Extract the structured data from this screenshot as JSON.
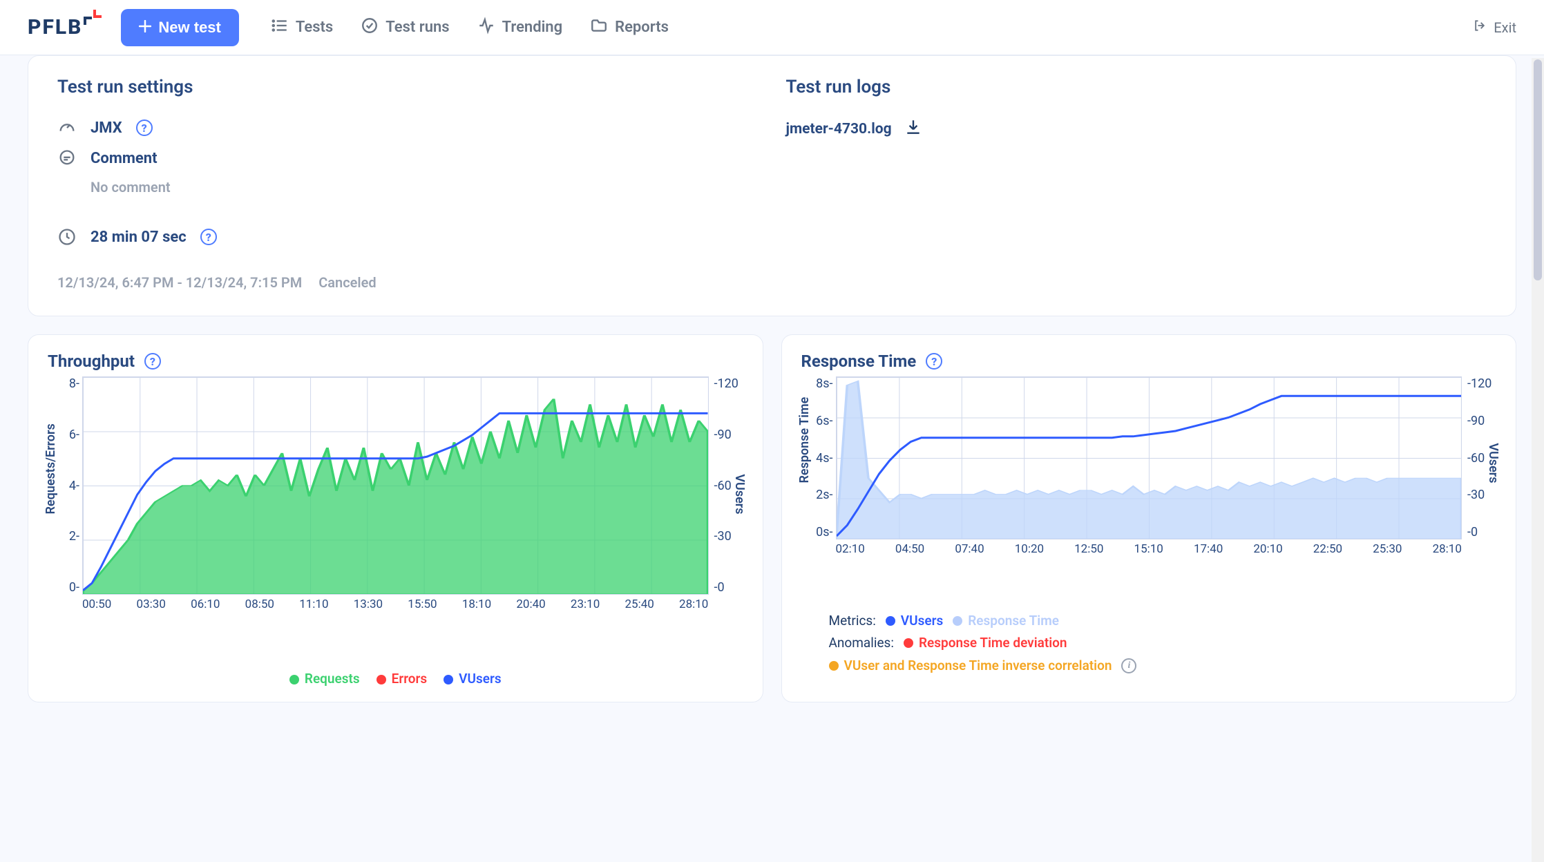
{
  "header": {
    "logo_text": "PFLB",
    "new_test_label": "New test",
    "nav": {
      "tests": "Tests",
      "test_runs": "Test runs",
      "trending": "Trending",
      "reports": "Reports"
    },
    "exit_label": "Exit"
  },
  "settings_card": {
    "title_left": "Test run settings",
    "title_right": "Test run logs",
    "jmx_label": "JMX",
    "comment_label": "Comment",
    "comment_value": "No comment",
    "duration_label": "28 min 07 sec",
    "timespan": "12/13/24, 6:47 PM - 12/13/24, 7:15 PM",
    "status": "Canceled",
    "log_file": "jmeter-4730.log"
  },
  "throughput_panel": {
    "title": "Throughput",
    "ylabel_left": "Requests/Errors",
    "ylabel_right": "VUsers",
    "legend": {
      "requests": "Requests",
      "errors": "Errors",
      "vusers": "VUsers"
    }
  },
  "response_panel": {
    "title": "Response Time",
    "ylabel_left": "Response Time",
    "ylabel_right": "VUsers",
    "metrics_label": "Metrics:",
    "anomalies_label": "Anomalies:",
    "legend": {
      "vusers": "VUsers",
      "response_time": "Response Time",
      "rt_deviation": "Response Time deviation",
      "inverse": "VUser and Response Time inverse correlation"
    }
  },
  "chart_data": [
    {
      "id": "throughput",
      "type": "line+area",
      "xticks": [
        "00:50",
        "03:30",
        "06:10",
        "08:50",
        "11:10",
        "13:30",
        "15:50",
        "18:10",
        "20:40",
        "23:10",
        "25:40",
        "28:10"
      ],
      "y_left": {
        "label": "Requests/Errors",
        "ticks": [
          0,
          2,
          4,
          6,
          8
        ],
        "range": [
          0,
          8
        ]
      },
      "y_right": {
        "label": "VUsers",
        "ticks": [
          0,
          30,
          60,
          90,
          120
        ],
        "range": [
          0,
          120
        ]
      },
      "series": [
        {
          "name": "Requests",
          "axis": "left",
          "style": "area",
          "color": "#3bd16f",
          "values": [
            0.1,
            0.4,
            0.8,
            1.2,
            1.6,
            2.0,
            2.6,
            3.0,
            3.4,
            3.6,
            3.8,
            4.0,
            4.0,
            4.2,
            3.8,
            4.2,
            4.0,
            4.4,
            3.6,
            4.4,
            4.0,
            4.6,
            5.2,
            3.8,
            5.0,
            3.6,
            4.6,
            5.4,
            3.8,
            5.0,
            4.2,
            5.4,
            3.8,
            5.2,
            4.6,
            5.0,
            4.0,
            5.6,
            4.2,
            5.2,
            4.4,
            5.6,
            4.6,
            5.8,
            4.8,
            6.0,
            5.0,
            6.4,
            5.2,
            6.6,
            5.4,
            6.8,
            7.2,
            5.0,
            6.4,
            5.6,
            7.0,
            5.4,
            6.6,
            5.6,
            7.0,
            5.4,
            6.6,
            5.8,
            7.0,
            5.6,
            6.8,
            5.6,
            6.4,
            6.0
          ]
        },
        {
          "name": "Errors",
          "axis": "left",
          "style": "area",
          "color": "#ff3b3b",
          "values": []
        },
        {
          "name": "VUsers",
          "axis": "right",
          "style": "line",
          "color": "#2e5bff",
          "values": [
            2,
            6,
            15,
            25,
            35,
            45,
            55,
            62,
            68,
            72,
            75,
            75,
            75,
            75,
            75,
            75,
            75,
            75,
            75,
            75,
            75,
            75,
            75,
            75,
            75,
            75,
            75,
            75,
            75,
            75,
            75,
            75,
            75,
            75,
            75,
            75,
            75,
            75,
            76,
            78,
            80,
            82,
            85,
            88,
            92,
            96,
            100,
            100,
            100,
            100,
            100,
            100,
            100,
            100,
            100,
            100,
            100,
            100,
            100,
            100,
            100,
            100,
            100,
            100,
            100,
            100,
            100,
            100,
            100,
            100
          ]
        }
      ]
    },
    {
      "id": "response_time",
      "type": "line+area",
      "xticks": [
        "02:10",
        "04:50",
        "07:40",
        "10:20",
        "12:50",
        "15:10",
        "17:40",
        "20:10",
        "22:50",
        "25:30",
        "28:10"
      ],
      "y_left": {
        "label": "Response Time",
        "unit": "s",
        "ticks": [
          0,
          2,
          4,
          6,
          8
        ],
        "range": [
          0,
          8
        ]
      },
      "y_right": {
        "label": "VUsers",
        "ticks": [
          0,
          30,
          60,
          90,
          120
        ],
        "range": [
          0,
          120
        ]
      },
      "series": [
        {
          "name": "Response Time",
          "axis": "left",
          "style": "area",
          "color": "#bdd5fb",
          "values": [
            0.2,
            7.6,
            7.8,
            3.0,
            2.4,
            1.8,
            2.2,
            2.2,
            2.0,
            2.2,
            2.2,
            2.2,
            2.2,
            2.2,
            2.4,
            2.2,
            2.2,
            2.4,
            2.2,
            2.4,
            2.2,
            2.4,
            2.2,
            2.4,
            2.4,
            2.2,
            2.4,
            2.2,
            2.6,
            2.2,
            2.4,
            2.2,
            2.6,
            2.4,
            2.6,
            2.4,
            2.6,
            2.4,
            2.8,
            2.6,
            2.8,
            2.6,
            2.8,
            2.6,
            2.8,
            3.0,
            2.8,
            3.0,
            2.8,
            3.0,
            3.0,
            2.8,
            3.0,
            3.0,
            3.0,
            3.0,
            3.0,
            3.0,
            3.0,
            3.0
          ]
        },
        {
          "name": "VUsers",
          "axis": "right",
          "style": "line",
          "color": "#2e5bff",
          "values": [
            2,
            10,
            22,
            35,
            48,
            58,
            66,
            72,
            75,
            75,
            75,
            75,
            75,
            75,
            75,
            75,
            75,
            75,
            75,
            75,
            75,
            75,
            75,
            75,
            75,
            75,
            75,
            76,
            76,
            77,
            78,
            79,
            80,
            82,
            84,
            86,
            88,
            90,
            93,
            96,
            100,
            103,
            106,
            106,
            106,
            106,
            106,
            106,
            106,
            106,
            106,
            106,
            106,
            106,
            106,
            106,
            106,
            106,
            106,
            106
          ]
        }
      ]
    }
  ]
}
